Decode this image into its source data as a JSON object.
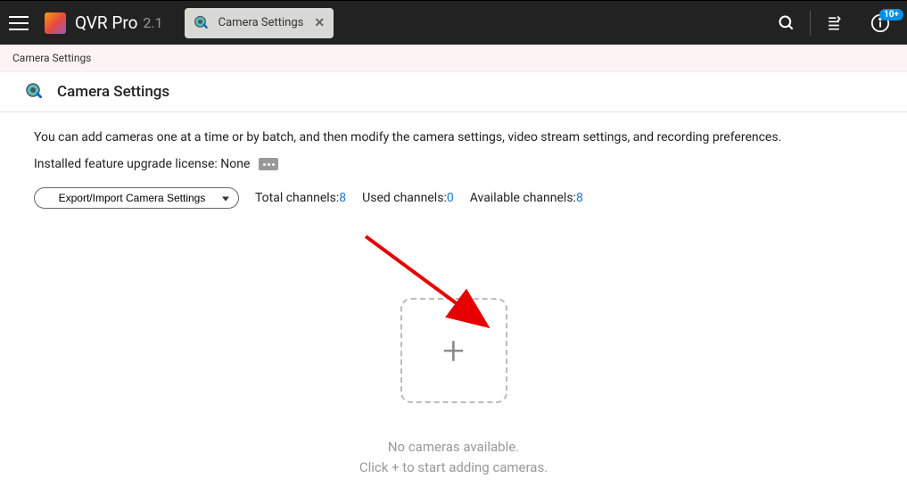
{
  "header": {
    "app_name": "QVR Pro",
    "app_version": "2.1",
    "tab_label": "Camera Settings",
    "notification_badge": "10+"
  },
  "breadcrumb": "Camera Settings",
  "page": {
    "title": "Camera Settings",
    "description": "You can add cameras one at a time or by batch, and then modify the camera settings, video stream settings, and recording preferences.",
    "license_label": "Installed feature upgrade license: None",
    "dropdown_label": "Export/Import Camera Settings",
    "stats": {
      "total_label": "Total channels:",
      "total_value": "8",
      "used_label": "Used channels:",
      "used_value": "0",
      "avail_label": "Available channels:",
      "avail_value": "8"
    },
    "empty": {
      "line1": "No cameras available.",
      "line2": "Click + to start adding cameras."
    }
  }
}
